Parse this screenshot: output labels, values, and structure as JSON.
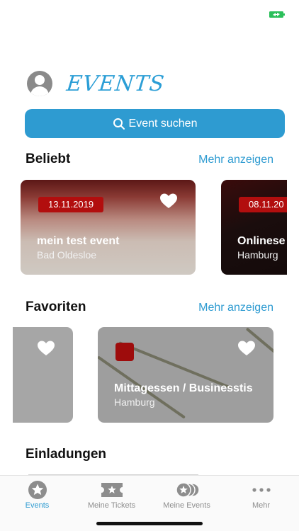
{
  "app": {
    "logo_text": "EVENTS",
    "accent_color": "#2e9bd1",
    "badge_color": "#b20e0e"
  },
  "search": {
    "label": "Event suchen",
    "icon": "search-icon"
  },
  "popular": {
    "title": "Beliebt",
    "more": "Mehr anzeigen",
    "cards": [
      {
        "date": "13.11.2019",
        "title": "mein test event",
        "city": "Bad Oldesloe"
      },
      {
        "date": "08.11.20",
        "title": "Onlinese",
        "city": "Hamburg"
      }
    ]
  },
  "favorites": {
    "title": "Favoriten",
    "more": "Mehr anzeigen",
    "cards": [
      {
        "title": "",
        "city": ""
      },
      {
        "title": "Mittagessen / Businesstis",
        "city": "Hamburg"
      }
    ]
  },
  "invitations": {
    "title": "Einladungen"
  },
  "tabbar": {
    "items": [
      {
        "label": "Events",
        "icon": "star-circle-icon",
        "active": true
      },
      {
        "label": "Meine Tickets",
        "icon": "ticket-icon",
        "active": false
      },
      {
        "label": "Meine Events",
        "icon": "stacked-coins-icon",
        "active": false
      },
      {
        "label": "Mehr",
        "icon": "more-dots-icon",
        "active": false
      }
    ]
  }
}
